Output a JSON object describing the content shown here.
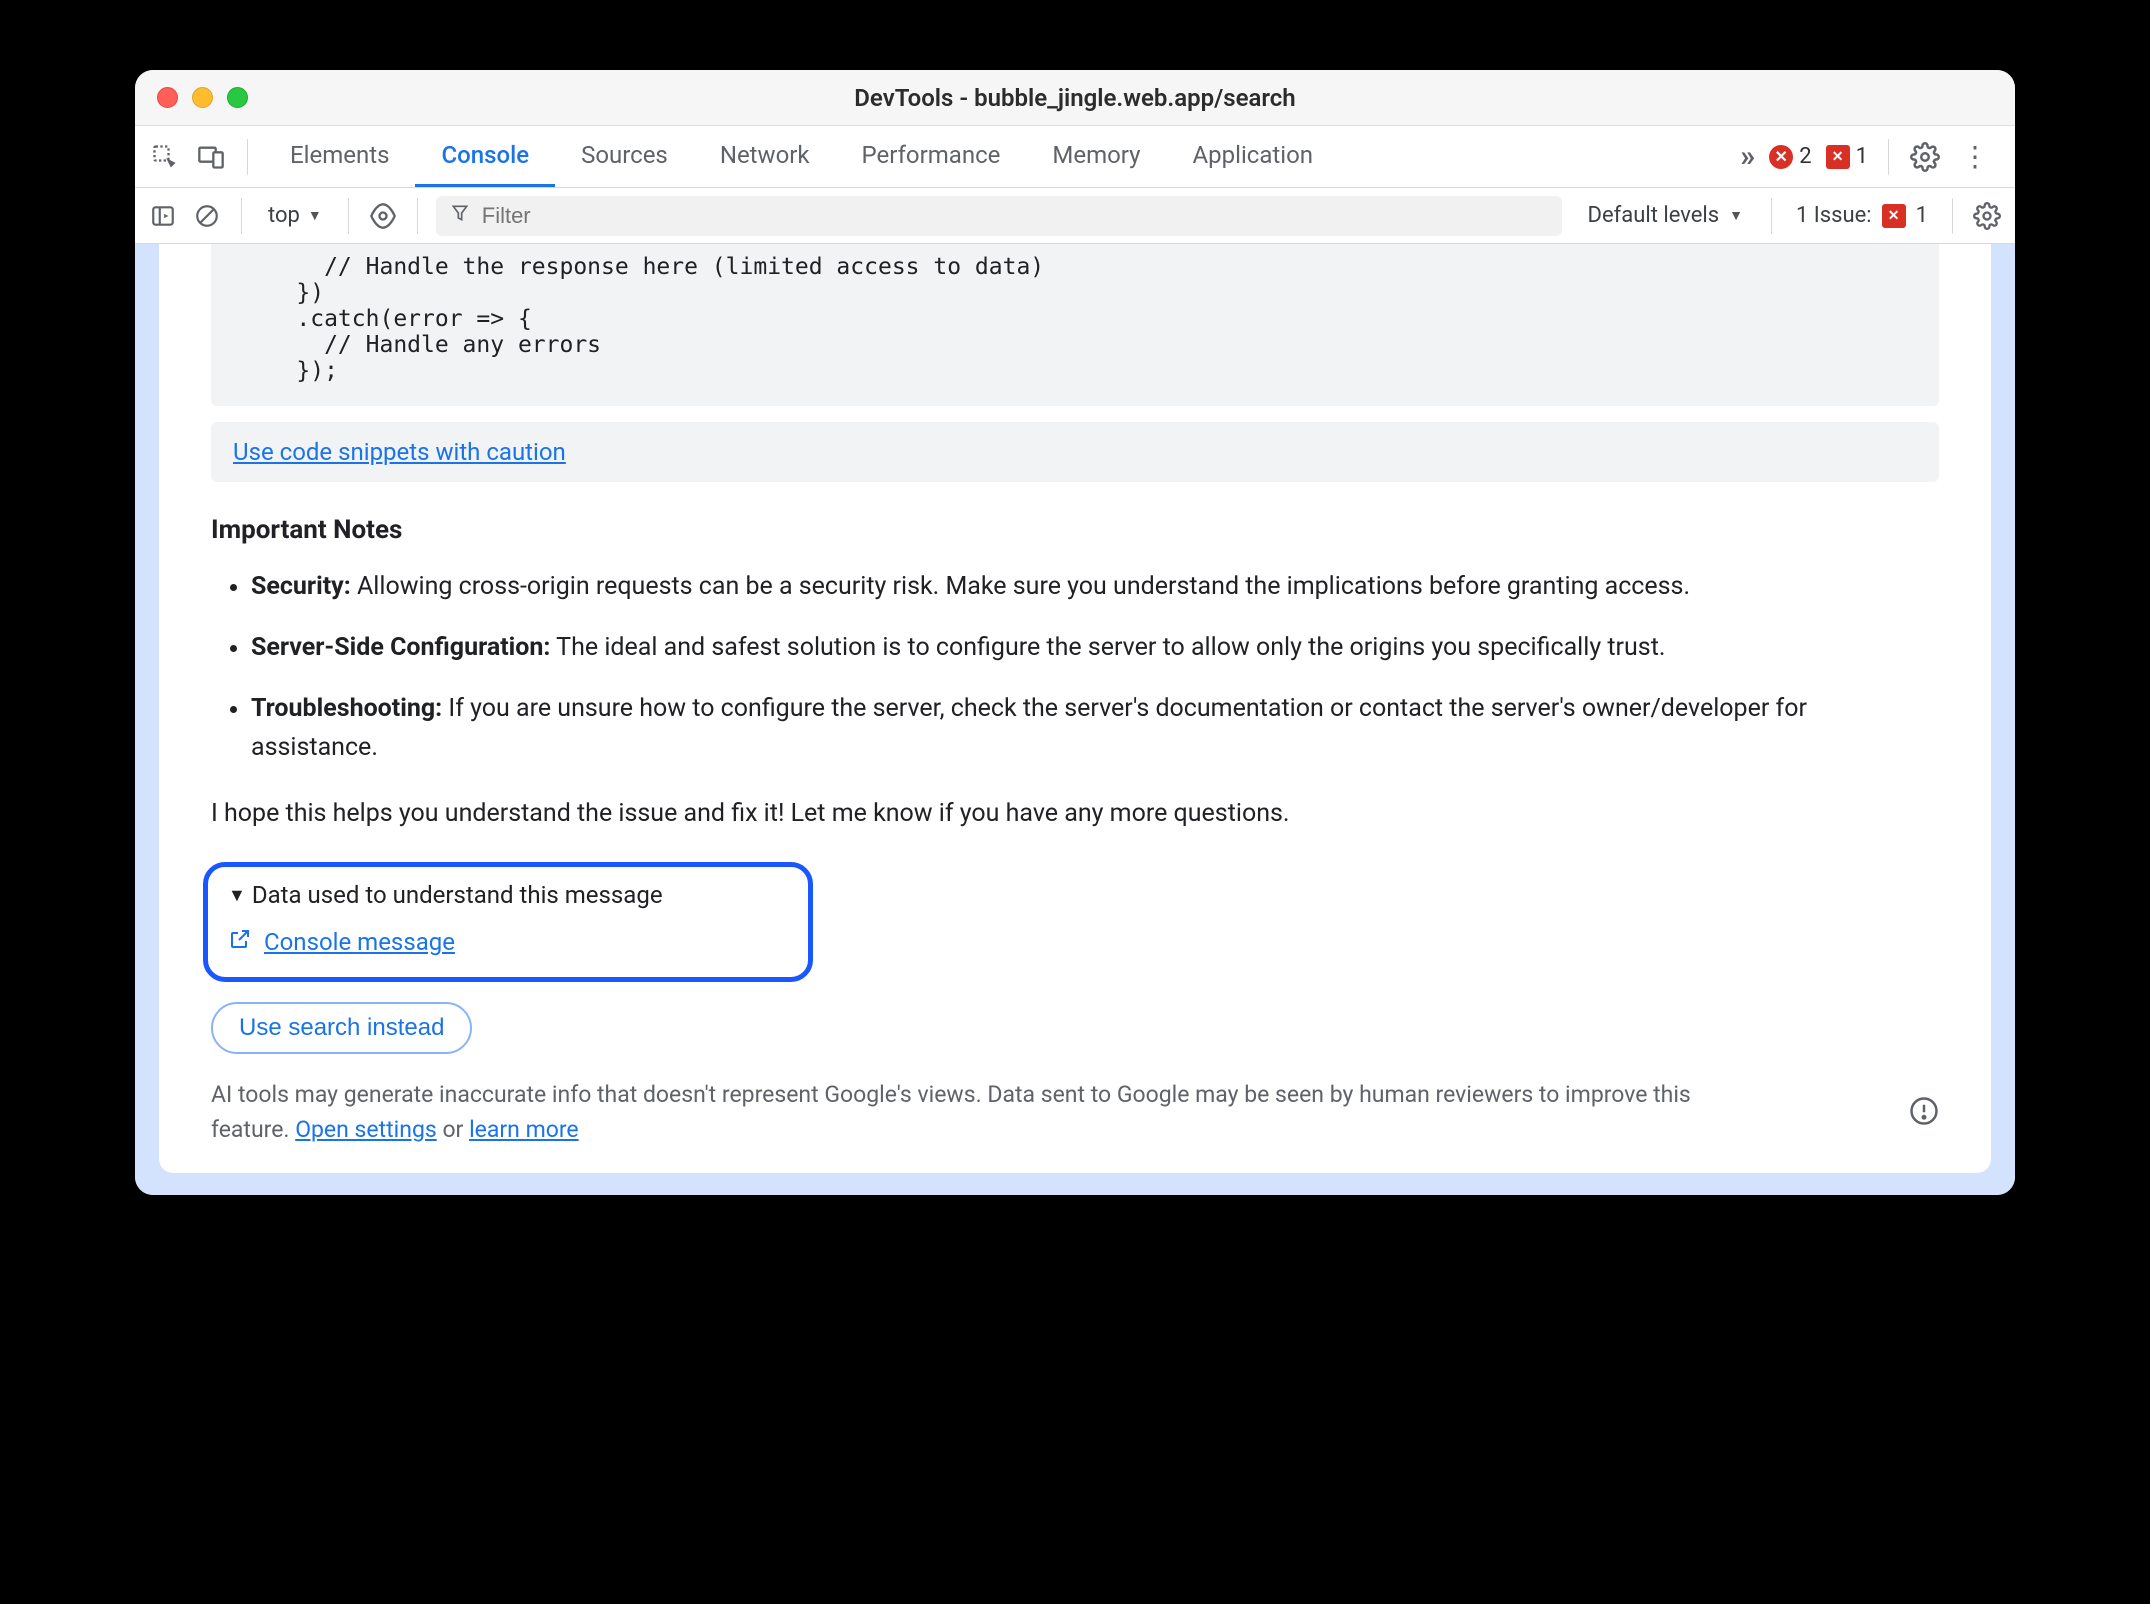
{
  "window": {
    "title": "DevTools - bubble_jingle.web.app/search"
  },
  "tabs": {
    "items": [
      "Elements",
      "Console",
      "Sources",
      "Network",
      "Performance",
      "Memory",
      "Application"
    ],
    "active": "Console"
  },
  "tabbar": {
    "error_count": "2",
    "flag_count": "1"
  },
  "console_toolbar": {
    "context": "top",
    "filter_placeholder": "Filter",
    "levels_label": "Default levels",
    "issues_label": "1 Issue:",
    "issues_count": "1"
  },
  "codeblock": "      // Handle the response here (limited access to data)\n    })\n    .catch(error => {\n      // Handle any errors\n    });",
  "caution_link": "Use code snippets with caution",
  "notes": {
    "heading": "Important Notes",
    "items": [
      {
        "label": "Security:",
        "text": " Allowing cross-origin requests can be a security risk. Make sure you understand the implications before granting access."
      },
      {
        "label": "Server-Side Configuration:",
        "text": " The ideal and safest solution is to configure the server to allow only the origins you specifically trust."
      },
      {
        "label": "Troubleshooting:",
        "text": " If you are unsure how to configure the server, check the server's documentation or contact the server's owner/developer for assistance."
      }
    ]
  },
  "closing": "I hope this helps you understand the issue and fix it! Let me know if you have any more questions.",
  "highlight": {
    "summary": "Data used to understand this message",
    "link": "Console message"
  },
  "search_button": "Use search instead",
  "footer": {
    "prefix": "AI tools may generate inaccurate info that doesn't represent Google's views. Data sent to Google may be seen by human reviewers to improve this feature. ",
    "open_settings": "Open settings",
    "or": " or ",
    "learn_more": "learn more"
  }
}
